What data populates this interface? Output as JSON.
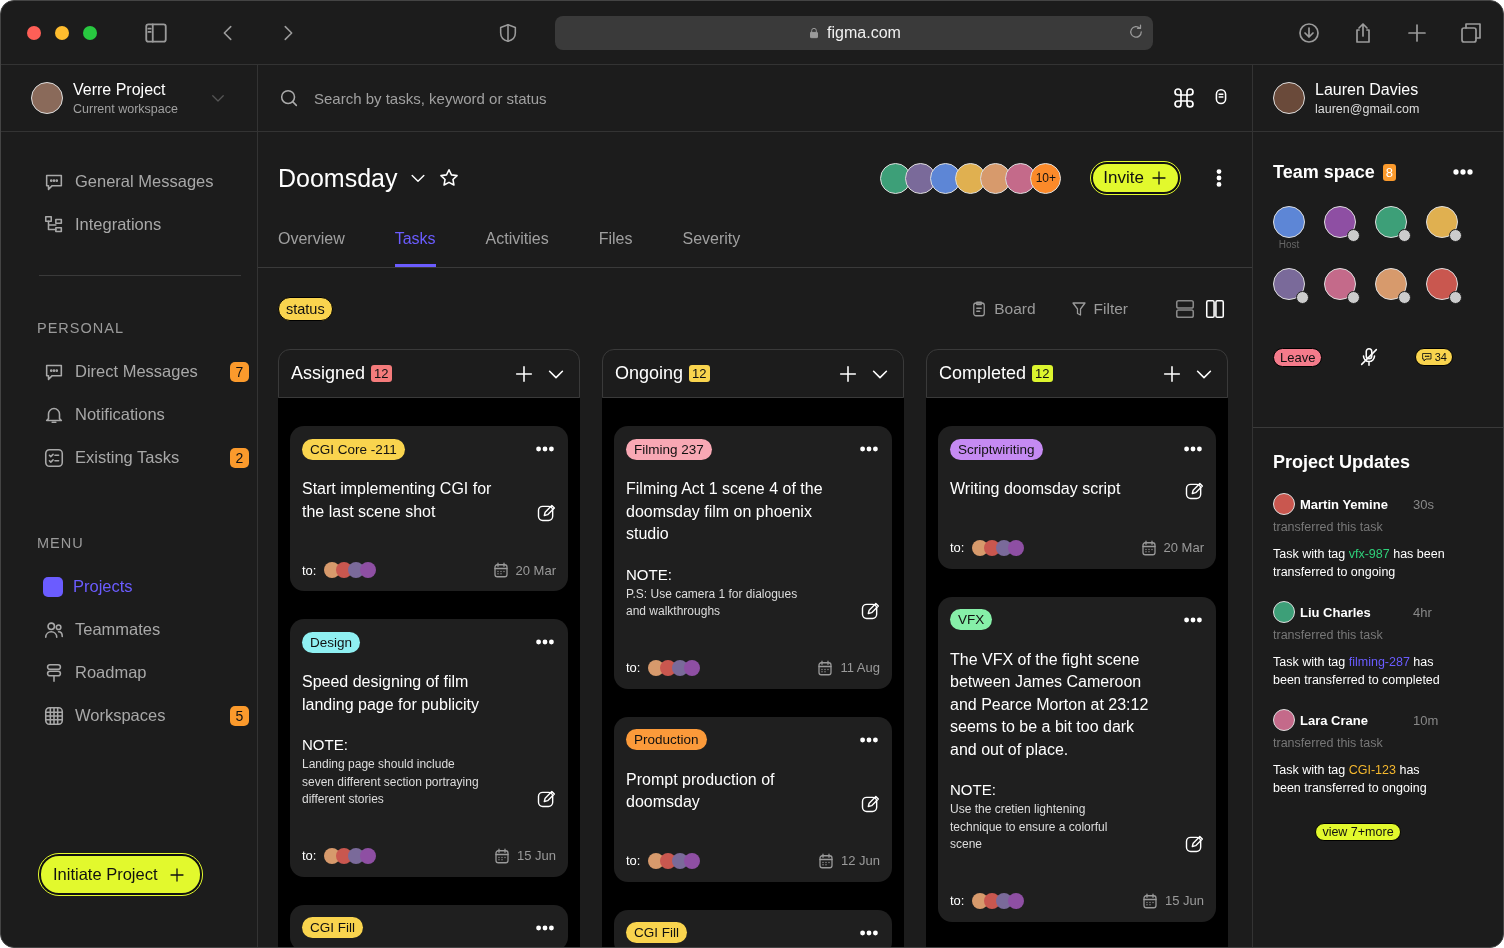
{
  "browser": {
    "url": "figma.com"
  },
  "workspace": {
    "name": "Verre Project",
    "subtitle": "Current workspace"
  },
  "sidebar": {
    "top_items": [
      {
        "label": "General Messages",
        "selected": false
      },
      {
        "label": "Integrations",
        "selected": false
      }
    ],
    "personal": {
      "heading": "PERSONAL",
      "items": [
        {
          "label": "Direct Messages",
          "badge": "7",
          "selected": false
        },
        {
          "label": "Notifications",
          "selected": false
        },
        {
          "label": "Existing Tasks",
          "badge": "2",
          "selected": false
        }
      ]
    },
    "menu": {
      "heading": "MENU",
      "items": [
        {
          "label": "Projects",
          "selected": true
        },
        {
          "label": "Teammates",
          "selected": false
        },
        {
          "label": "Roadmap",
          "selected": false
        },
        {
          "label": "Workspaces",
          "badge": "5",
          "selected": false
        }
      ]
    },
    "action_button": "Initiate Project"
  },
  "search": {
    "placeholder": "Search by tasks, keyword or status"
  },
  "project": {
    "title": "Doomsday",
    "members_more": "10+",
    "invite_button": "Invite"
  },
  "tabs": [
    {
      "label": "Overview",
      "selected": false
    },
    {
      "label": "Tasks",
      "selected": true
    },
    {
      "label": "Activities",
      "selected": false
    },
    {
      "label": "Files",
      "selected": false
    },
    {
      "label": "Severity",
      "selected": false
    }
  ],
  "toolbar": {
    "status_chip": "status",
    "board": "Board",
    "filter": "Filter",
    "views": [
      {
        "selected": false
      },
      {
        "selected": true
      }
    ]
  },
  "columns": [
    {
      "title": "Assigned",
      "count": "12",
      "color": "#f47b7b",
      "cards": [
        {
          "tag": "CGI Core -211",
          "color": "#f9d44e",
          "title": "Start implementing CGI for the last scene shot",
          "assign_label": "to:",
          "date": "20 Mar"
        },
        {
          "tag": "Design",
          "color": "#8ff0f2",
          "title": "Speed designing of film landing page for publicity",
          "note_label": "NOTE:",
          "note": "Landing page should include seven different section portraying different stories",
          "assign_label": "to:",
          "date": "15 Jun"
        },
        {
          "tag": "CGI Fill",
          "color": "#f9d44e"
        }
      ]
    },
    {
      "title": "Ongoing",
      "count": "12",
      "color": "#f9d44e",
      "cards": [
        {
          "tag": "Filming 237",
          "color": "#f8a8b4",
          "title": "Filming Act 1 scene 4 of the doomsday film on phoenix studio",
          "note_label": "NOTE:",
          "note": "P.S: Use camera 1 for dialogues and walkthroughs",
          "assign_label": "to:",
          "date": "11 Aug"
        },
        {
          "tag": "Production",
          "color": "#fb9a3a",
          "title": "Prompt production of doomsday",
          "assign_label": "to:",
          "date": "12 Jun"
        },
        {
          "tag": "CGI Fill",
          "color": "#f9d44e"
        }
      ]
    },
    {
      "title": "Completed",
      "count": "12",
      "color": "#dcf52e",
      "cards": [
        {
          "tag": "Scriptwiriting",
          "color": "#c58af2",
          "title": "Writing doomsday script",
          "assign_label": "to:",
          "date": "20 Mar"
        },
        {
          "tag": "VFX",
          "color": "#86efa8",
          "title": "The VFX of the fight scene between James Cameroon and Pearce Morton at 23:12 seems to be a bit too dark and out of place.",
          "note_label": "NOTE:",
          "note": "Use the cretien lightening technique to ensure a colorful scene",
          "assign_label": "to:",
          "date": "15 Jun"
        }
      ]
    }
  ],
  "user": {
    "name": "Lauren Davies",
    "email": "lauren@gmail.com"
  },
  "team_space": {
    "title": "Team space",
    "count": "8",
    "members": [
      {
        "caption": "Host",
        "muted": false
      },
      {
        "muted": true
      },
      {
        "muted": true
      },
      {
        "muted": true
      },
      {
        "muted": true
      },
      {
        "muted": true
      },
      {
        "muted": true
      },
      {
        "muted": true
      }
    ],
    "leave_button": "Leave",
    "mic_muted": true,
    "chat_count": "34"
  },
  "updates": {
    "title": "Project Updates",
    "items": [
      {
        "name": "Martin Yemine",
        "time": "30s",
        "action": "transferred this task",
        "before": "Task with tag ",
        "tag": "vfx-987",
        "color": "#2fd07a",
        "after": " has been transferred to ongoing"
      },
      {
        "name": "Liu Charles",
        "time": "4hr",
        "action": "transferred this task",
        "before": "Task with tag ",
        "tag": "filming-287",
        "color": "#6a5cff",
        "after": " has been transferred to completed"
      },
      {
        "name": "Lara Crane",
        "time": "10m",
        "action": "transferred this task",
        "before": "Task with tag ",
        "tag": "CGI-123",
        "color": "#f5b82e",
        "after": " has been transferred to ongoing"
      }
    ],
    "more_button": "view 7+more"
  }
}
